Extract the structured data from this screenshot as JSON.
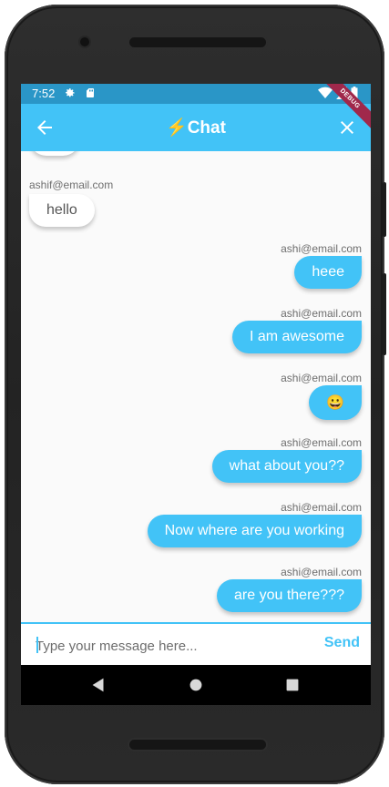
{
  "status_bar": {
    "time": "7:52"
  },
  "app_bar": {
    "title": "⚡Chat",
    "debug_label": "DEBUG"
  },
  "messages": [
    {
      "sender": "",
      "text": "",
      "mine": false
    },
    {
      "sender": "ashif@email.com",
      "text": "hello",
      "mine": false
    },
    {
      "sender": "ashi@email.com",
      "text": "heee",
      "mine": true
    },
    {
      "sender": "ashi@email.com",
      "text": "I am awesome",
      "mine": true
    },
    {
      "sender": "ashi@email.com",
      "text": "😀",
      "mine": true
    },
    {
      "sender": "ashi@email.com",
      "text": "what about you??",
      "mine": true
    },
    {
      "sender": "ashi@email.com",
      "text": "Now where are you working",
      "mine": true
    },
    {
      "sender": "ashi@email.com",
      "text": "are you there???",
      "mine": true
    }
  ],
  "composer": {
    "placeholder": "Type your message here...",
    "send_label": "Send"
  },
  "colors": {
    "accent": "#42c3f7",
    "status_bar": "#2a96c7",
    "debug_banner": "#a0284b"
  }
}
